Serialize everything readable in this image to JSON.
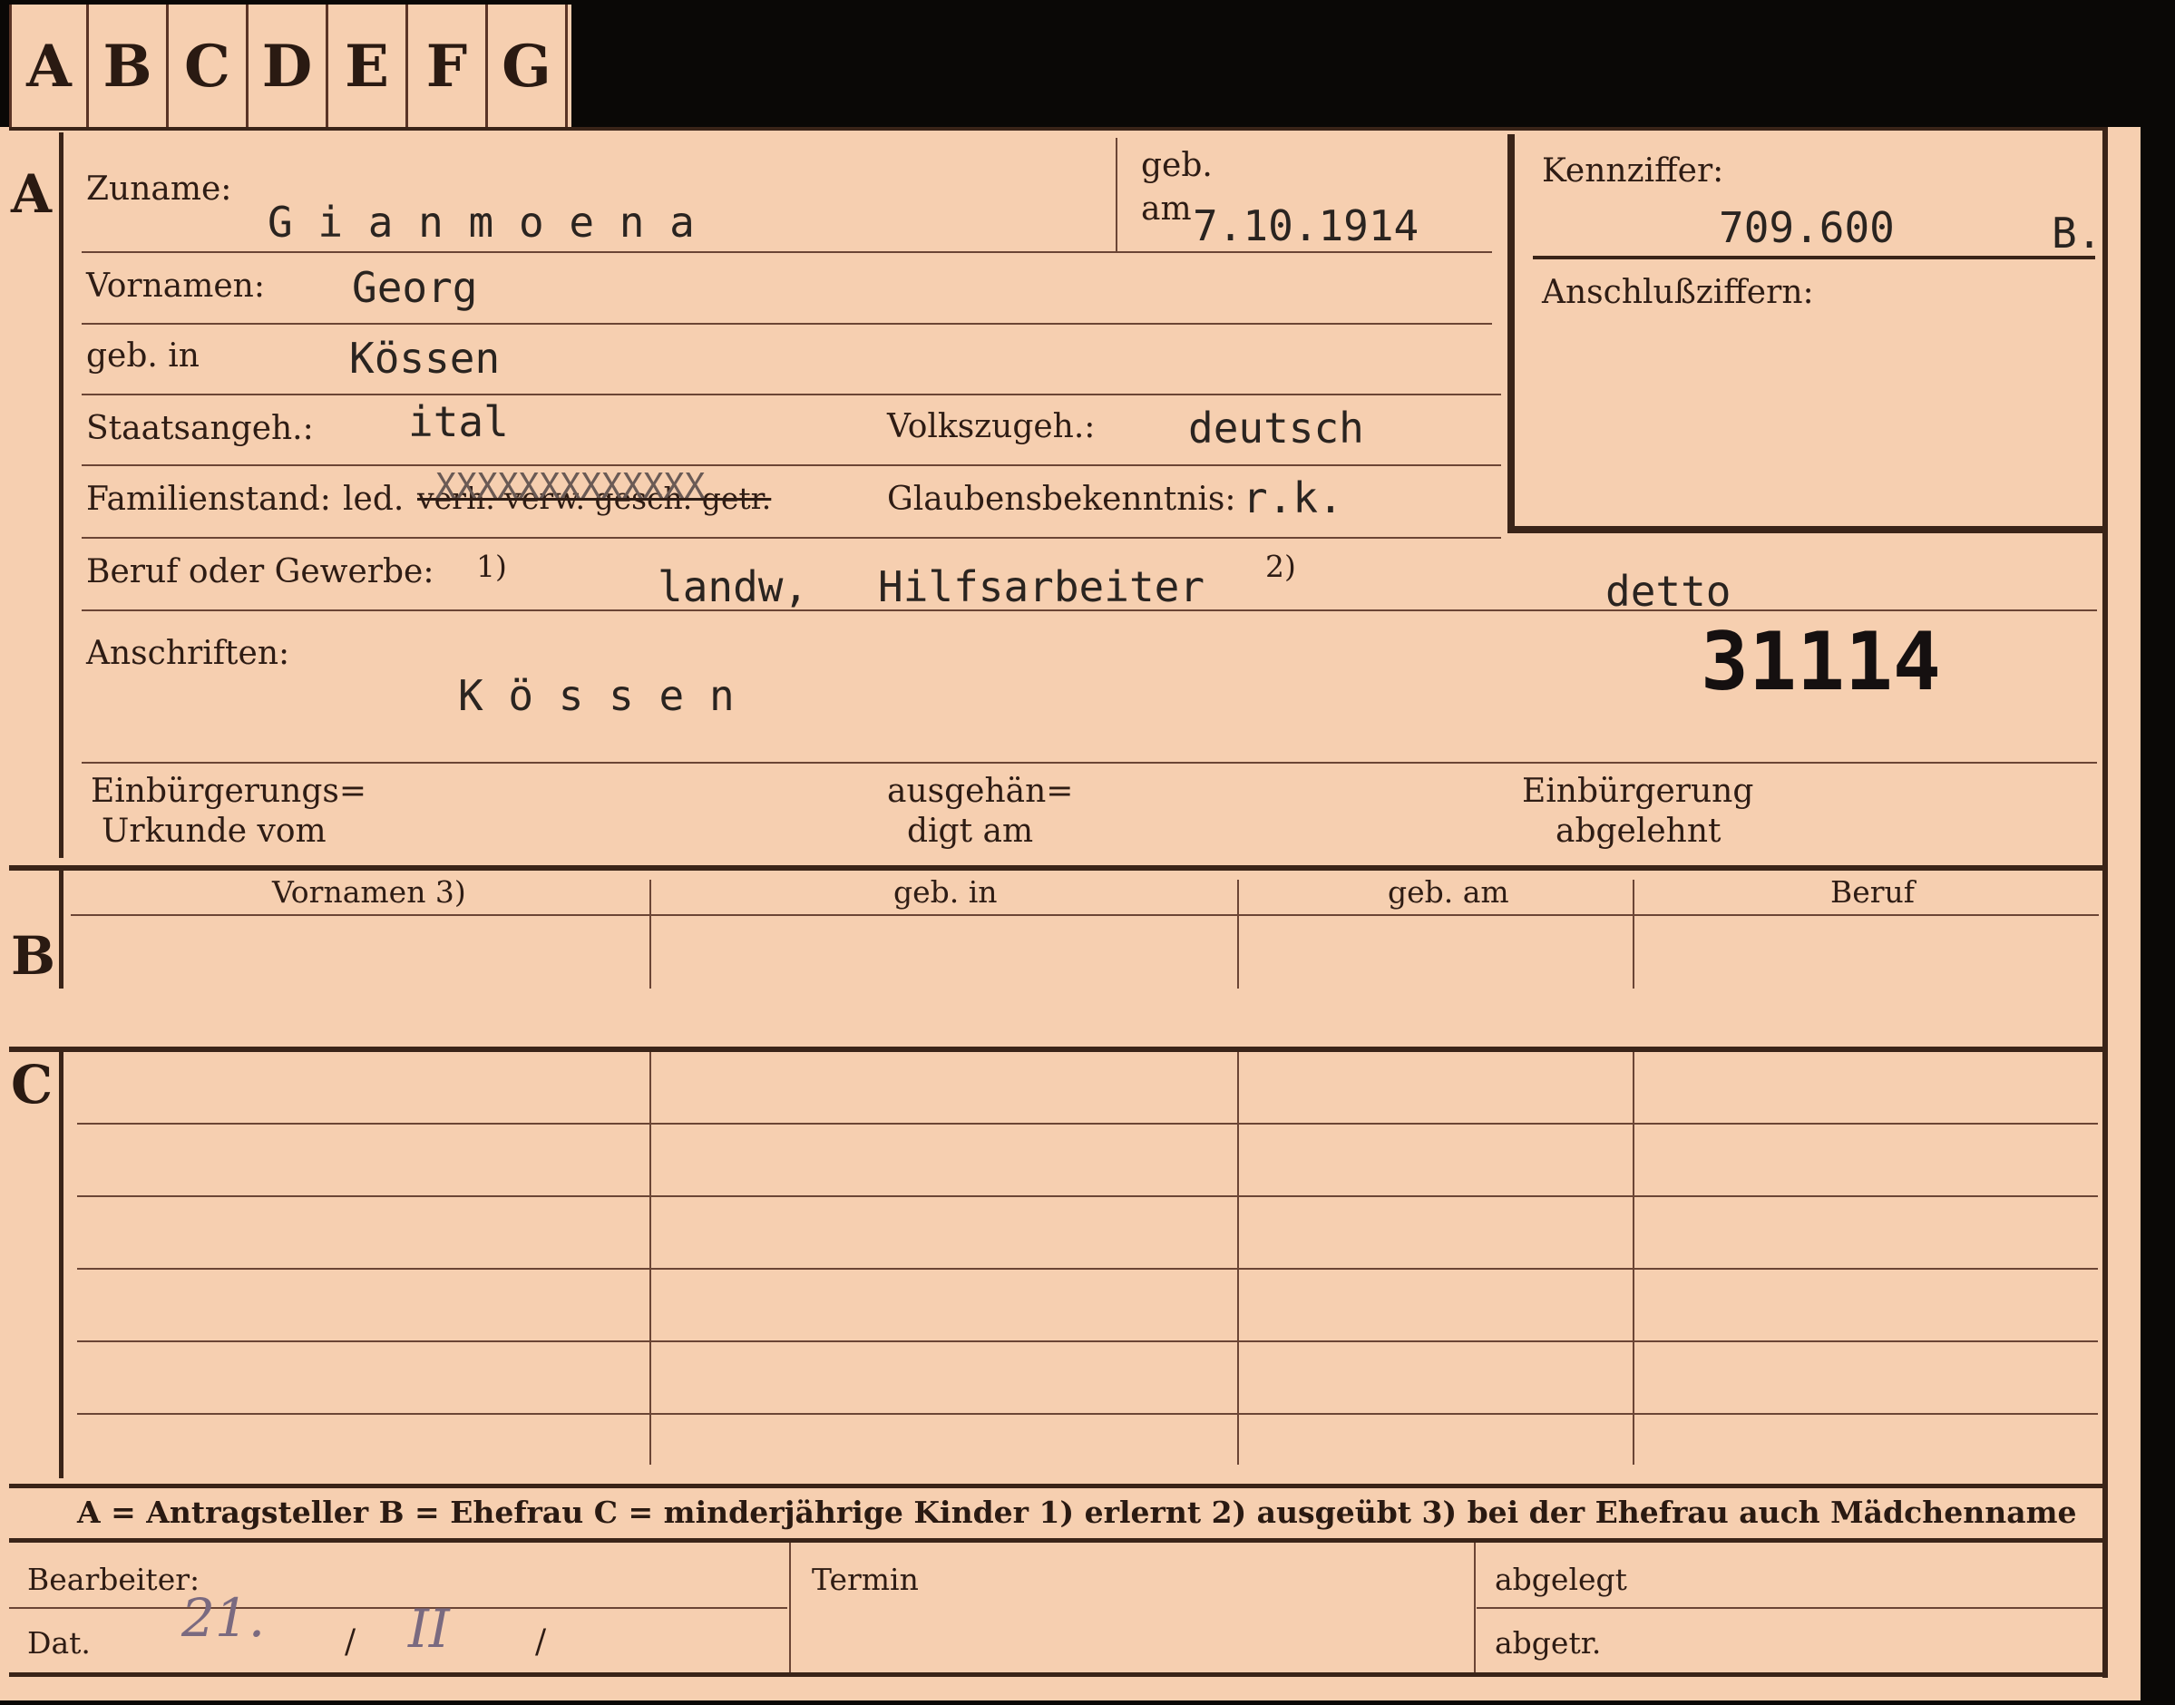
{
  "tabs": [
    "A",
    "B",
    "C",
    "D",
    "E",
    "F",
    "G"
  ],
  "sections": {
    "a": "A",
    "b": "B",
    "c": "C"
  },
  "fields": {
    "zuname_label": "Zuname:",
    "zuname_value": "G i a n m o e n a",
    "geb_am_label_1": "geb.",
    "geb_am_label_2": "am",
    "geb_am_value": "7.10.1914",
    "kennziffer_label": "Kennziffer:",
    "kennziffer_value": "709.600",
    "kennziffer_suffix": "B.",
    "anschluss_label": "Anschlußziffern:",
    "vornamen_label": "Vornamen:",
    "vornamen_value": "Georg",
    "gebin_label": "geb. in",
    "gebin_value": "Kössen",
    "staats_label": "Staatsangeh.:",
    "staats_value": "ital",
    "volks_label": "Volkszugeh.:",
    "volks_value": "deutsch",
    "familien_label": "Familienstand:",
    "familien_led": "led.",
    "familien_struck": "verh. verw. gesch. getr.",
    "familien_x": "XXXXXXXXXXXXX",
    "glaubens_label": "Glaubensbekenntnis:",
    "glaubens_value": "r.k.",
    "beruf_label": "Beruf oder Gewerbe:",
    "beruf_note1": "1)",
    "beruf_value1": "landw,",
    "beruf_value2": "Hilfsarbeiter",
    "beruf_note2": "2)",
    "beruf_value3": "detto",
    "anschriften_label": "Anschriften:",
    "anschriften_value": "K ö s s e n",
    "stamp_number": "31114",
    "einb_urk_1": "Einbürgerungs=",
    "einb_urk_2": "Urkunde vom",
    "ausgeh_1": "ausgehän=",
    "ausgeh_2": "digt am",
    "einb_abg_1": "Einbürgerung",
    "einb_abg_2": "abgelehnt"
  },
  "table_b": {
    "headers": [
      "Vornamen 3)",
      "geb. in",
      "geb. am",
      "Beruf"
    ]
  },
  "footer": {
    "legend": "A = Antragsteller    B = Ehefrau    C = minderjährige Kinder    1) erlernt    2) ausgeübt    3) bei der Ehefrau auch Mädchenname",
    "bearbeiter_label": "Bearbeiter:",
    "dat_label": "Dat.",
    "dat_day": "21.",
    "dat_sep1": "/",
    "dat_month": "II",
    "dat_sep2": "/",
    "termin_label": "Termin",
    "abgelegt_label": "abgelegt",
    "abgetr_label": "abgetr."
  },
  "colors": {
    "paper": "#f6cfb0",
    "ink": "#2a1a12",
    "background": "#0a0806"
  }
}
